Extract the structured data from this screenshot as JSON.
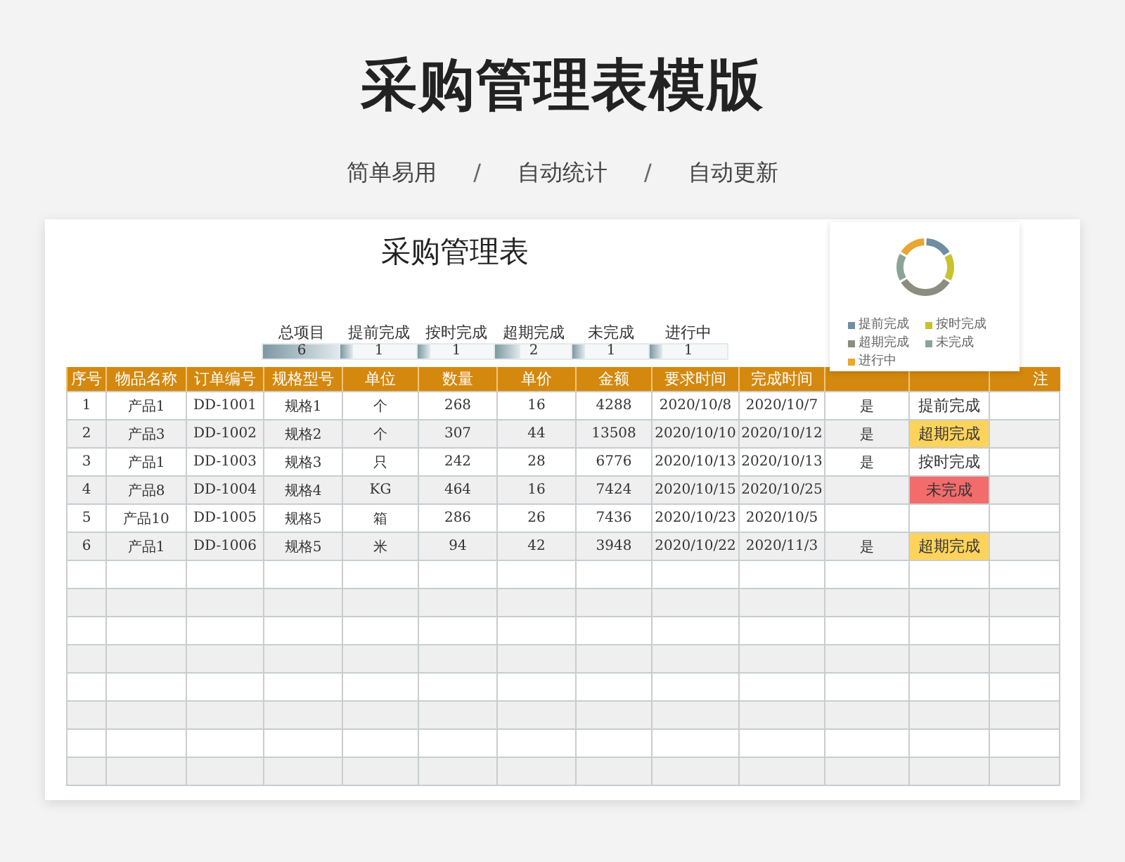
{
  "page_title": "采购管理表模版",
  "taglines": [
    "简单易用",
    "自动统计",
    "自动更新"
  ],
  "separator": "/",
  "sheet_title": "采购管理表",
  "summary": [
    {
      "label": "总项目",
      "value": "6",
      "level": 1
    },
    {
      "label": "提前完成",
      "value": "1",
      "level": 0.16
    },
    {
      "label": "按时完成",
      "value": "1",
      "level": 0.16
    },
    {
      "label": "超期完成",
      "value": "2",
      "level": 0.33
    },
    {
      "label": "未完成",
      "value": "1",
      "level": 0.16
    },
    {
      "label": "进行中",
      "value": "1",
      "level": 0.16
    }
  ],
  "legend": [
    {
      "label": "提前完成",
      "color": "#6f8ea1"
    },
    {
      "label": "按时完成",
      "color": "#c9c22c"
    },
    {
      "label": "超期完成",
      "color": "#8c8c80"
    },
    {
      "label": "未完成",
      "color": "#8aa597"
    },
    {
      "label": "进行中",
      "color": "#e9a632"
    }
  ],
  "columns": [
    "序号",
    "物品名称",
    "订单编号",
    "规格型号",
    "单位",
    "数量",
    "单价",
    "金额",
    "要求时间",
    "完成时间"
  ],
  "column_13": "注",
  "rows": [
    {
      "cells": [
        "1",
        "产品1",
        "DD-1001",
        "规格1",
        "个",
        "268",
        "16",
        "4288",
        "2020/10/8",
        "2020/10/7"
      ],
      "column_11": "是",
      "status": {
        "text": "提前完成",
        "kind": "early"
      }
    },
    {
      "cells": [
        "2",
        "产品3",
        "DD-1002",
        "规格2",
        "个",
        "307",
        "44",
        "13508",
        "2020/10/10",
        "2020/10/12"
      ],
      "column_11": "是",
      "status": {
        "text": "超期完成",
        "kind": "overdue"
      }
    },
    {
      "cells": [
        "3",
        "产品1",
        "DD-1003",
        "规格3",
        "只",
        "242",
        "28",
        "6776",
        "2020/10/13",
        "2020/10/13"
      ],
      "column_11": "是",
      "status": {
        "text": "按时完成",
        "kind": "ontime"
      }
    },
    {
      "cells": [
        "4",
        "产品8",
        "DD-1004",
        "规格4",
        "KG",
        "464",
        "16",
        "7424",
        "2020/10/15",
        "2020/10/25"
      ],
      "status": {
        "text": "未完成",
        "kind": "incomplete"
      }
    },
    {
      "cells": [
        "5",
        "产品10",
        "DD-1005",
        "规格5",
        "箱",
        "286",
        "26",
        "7436",
        "2020/10/23",
        "2020/10/5"
      ]
    },
    {
      "cells": [
        "6",
        "产品1",
        "DD-1006",
        "规格5",
        "米",
        "94",
        "42",
        "3948",
        "2020/10/22",
        "2020/11/3"
      ],
      "column_11": "是",
      "status": {
        "text": "超期完成",
        "kind": "overdue"
      }
    }
  ]
}
